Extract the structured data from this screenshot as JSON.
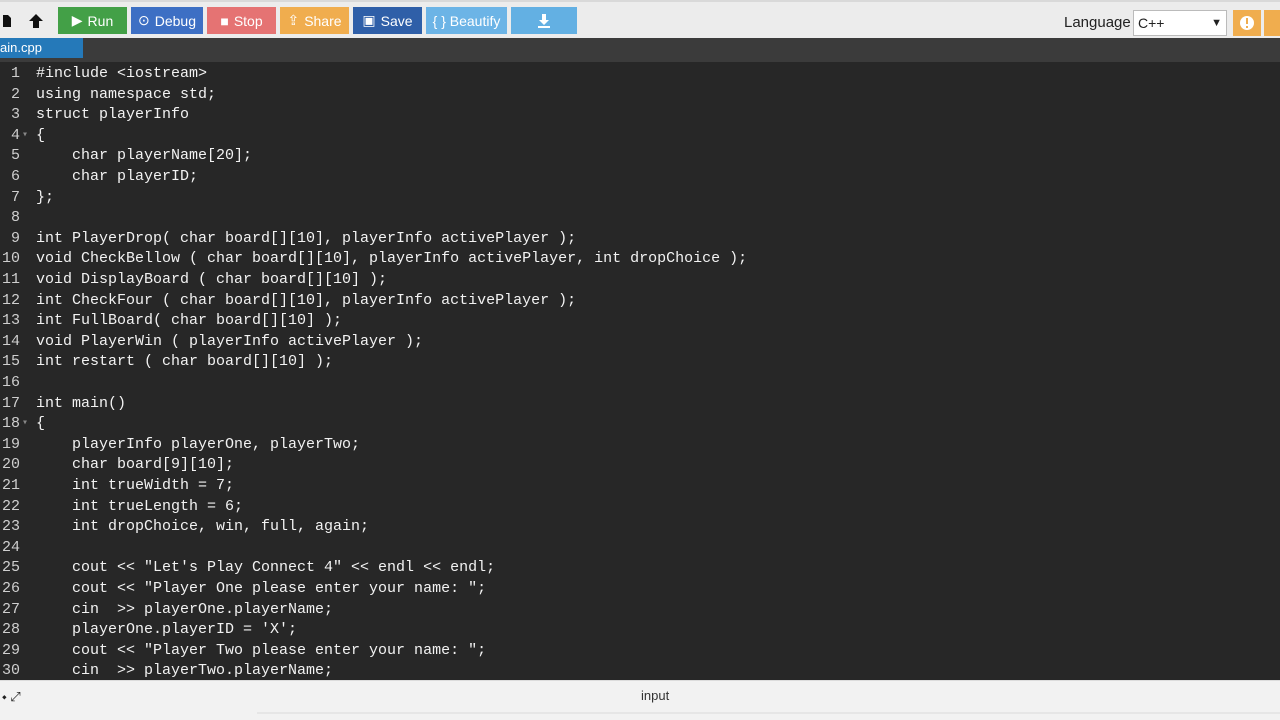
{
  "toolbar": {
    "run": "Run",
    "debug": "Debug",
    "stop": "Stop",
    "share": "Share",
    "save": "Save",
    "beautify": "{ } Beautify",
    "language_label": "Language",
    "language_value": "C++",
    "colors": {
      "run": "#43a047",
      "debug": "#3d6fc4",
      "stop": "#e57373",
      "share": "#f0ad4e",
      "save": "#2f5fa8",
      "beautify": "#6cb4e6",
      "warn": "#f0ad4e"
    }
  },
  "tab": {
    "filename": "ain.cpp"
  },
  "editor": {
    "background": "#272727",
    "lines": [
      {
        "n": "1",
        "fold": "",
        "text": "#include <iostream>"
      },
      {
        "n": "2",
        "fold": "",
        "text": "using namespace std;"
      },
      {
        "n": "3",
        "fold": "",
        "text": "struct playerInfo"
      },
      {
        "n": "4",
        "fold": "▾",
        "text": "{"
      },
      {
        "n": "5",
        "fold": "",
        "text": "    char playerName[20];"
      },
      {
        "n": "6",
        "fold": "",
        "text": "    char playerID;"
      },
      {
        "n": "7",
        "fold": "",
        "text": "};"
      },
      {
        "n": "8",
        "fold": "",
        "text": ""
      },
      {
        "n": "9",
        "fold": "",
        "text": "int PlayerDrop( char board[][10], playerInfo activePlayer );"
      },
      {
        "n": "10",
        "fold": "",
        "text": "void CheckBellow ( char board[][10], playerInfo activePlayer, int dropChoice );"
      },
      {
        "n": "11",
        "fold": "",
        "text": "void DisplayBoard ( char board[][10] );"
      },
      {
        "n": "12",
        "fold": "",
        "text": "int CheckFour ( char board[][10], playerInfo activePlayer );"
      },
      {
        "n": "13",
        "fold": "",
        "text": "int FullBoard( char board[][10] );"
      },
      {
        "n": "14",
        "fold": "",
        "text": "void PlayerWin ( playerInfo activePlayer );"
      },
      {
        "n": "15",
        "fold": "",
        "text": "int restart ( char board[][10] );"
      },
      {
        "n": "16",
        "fold": "",
        "text": ""
      },
      {
        "n": "17",
        "fold": "",
        "text": "int main()"
      },
      {
        "n": "18",
        "fold": "▾",
        "text": "{"
      },
      {
        "n": "19",
        "fold": "",
        "text": "    playerInfo playerOne, playerTwo;"
      },
      {
        "n": "20",
        "fold": "",
        "text": "    char board[9][10];"
      },
      {
        "n": "21",
        "fold": "",
        "text": "    int trueWidth = 7;"
      },
      {
        "n": "22",
        "fold": "",
        "text": "    int trueLength = 6;"
      },
      {
        "n": "23",
        "fold": "",
        "text": "    int dropChoice, win, full, again;"
      },
      {
        "n": "24",
        "fold": "",
        "text": ""
      },
      {
        "n": "25",
        "fold": "",
        "text": "    cout << \"Let's Play Connect 4\" << endl << endl;"
      },
      {
        "n": "26",
        "fold": "",
        "text": "    cout << \"Player One please enter your name: \";"
      },
      {
        "n": "27",
        "fold": "",
        "text": "    cin  >> playerOne.playerName;"
      },
      {
        "n": "28",
        "fold": "",
        "text": "    playerOne.playerID = 'X';"
      },
      {
        "n": "29",
        "fold": "",
        "text": "    cout << \"Player Two please enter your name: \";"
      },
      {
        "n": "30",
        "fold": "",
        "text": "    cin  >> playerTwo.playerName;"
      }
    ]
  },
  "bottom": {
    "label": "input"
  }
}
